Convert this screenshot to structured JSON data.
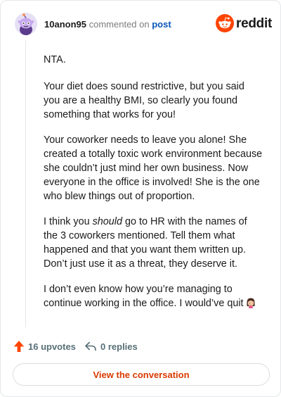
{
  "header": {
    "username": "10anon95",
    "commented_text": "commented on",
    "post_link": "post",
    "brand_name": "reddit",
    "avatar_icon": "snoo-avatar-icon",
    "brand_icon": "reddit-logo-icon"
  },
  "comment": {
    "p1": "NTA.",
    "p2": "Your diet does sound restrictive, but you said you are a healthy BMI, so clearly you found something that works for you!",
    "p3": "Your coworker needs to leave you alone! She created a totally toxic work environment because she couldn’t just mind her own business. Now everyone in the office is involved! She is the one who blew things out of proportion.",
    "p4_pre": "I think you ",
    "p4_em": "should",
    "p4_post": " go to HR with the names of the 3 coworkers mentioned. Tell them what happened and that you want them written up. Don’t just use it as a threat, they deserve it.",
    "p5": "I don’t even know how you’re managing to continue working in the office. I would’ve quit",
    "emoji": "woman-facepalming-emoji"
  },
  "actions": {
    "upvotes": "16 upvotes",
    "replies": "0 replies",
    "upvote_icon": "upvote-arrow-icon",
    "reply_icon": "reply-arrow-icon"
  },
  "cta": {
    "label": "View the conversation"
  },
  "colors": {
    "brand_orange": "#ff4500",
    "link_blue": "#0a56b8",
    "cta_text": "#d93a00",
    "muted": "#576f76"
  }
}
